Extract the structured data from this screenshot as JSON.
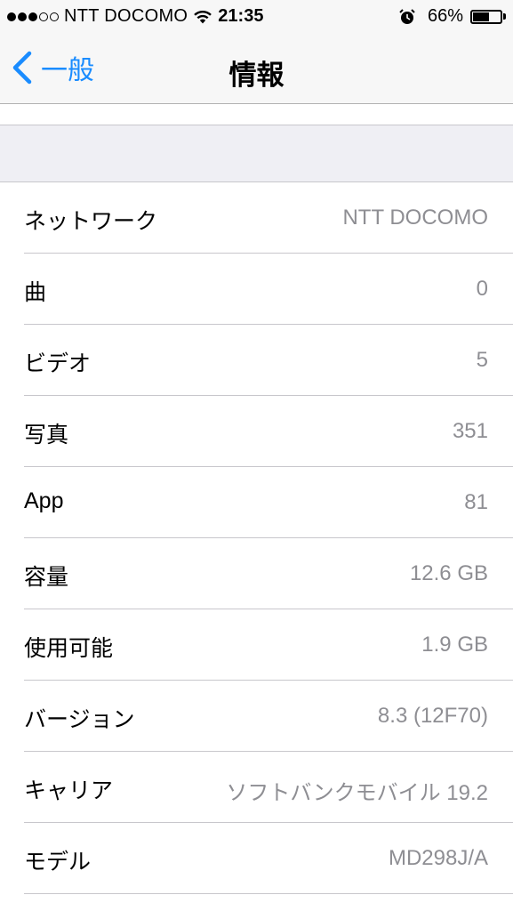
{
  "status_bar": {
    "signal_bars_filled": 3,
    "signal_bars_total": 5,
    "carrier": "NTT DOCOMO",
    "time": "21:35",
    "battery_percent": "66%",
    "battery_level": 0.66,
    "icons": [
      "wifi-icon",
      "alarm-clock-icon",
      "battery-icon"
    ]
  },
  "nav": {
    "back_label": "一般",
    "title": "情報"
  },
  "rows": [
    {
      "label": "ネットワーク",
      "value": "NTT DOCOMO"
    },
    {
      "label": "曲",
      "value": "0"
    },
    {
      "label": "ビデオ",
      "value": "5"
    },
    {
      "label": "写真",
      "value": "351"
    },
    {
      "label": "App",
      "value": "81"
    },
    {
      "label": "容量",
      "value": "12.6 GB"
    },
    {
      "label": "使用可能",
      "value": "1.9 GB"
    },
    {
      "label": "バージョン",
      "value": "8.3 (12F70)"
    },
    {
      "label": "キャリア",
      "value": "ソフトバンクモバイル 19.2"
    },
    {
      "label": "モデル",
      "value": "MD298J/A"
    }
  ],
  "colors": {
    "accent": "#1a8cff",
    "value_text": "#8e8e93",
    "bar_background": "#f7f7f7",
    "group_background": "#efeff4"
  }
}
